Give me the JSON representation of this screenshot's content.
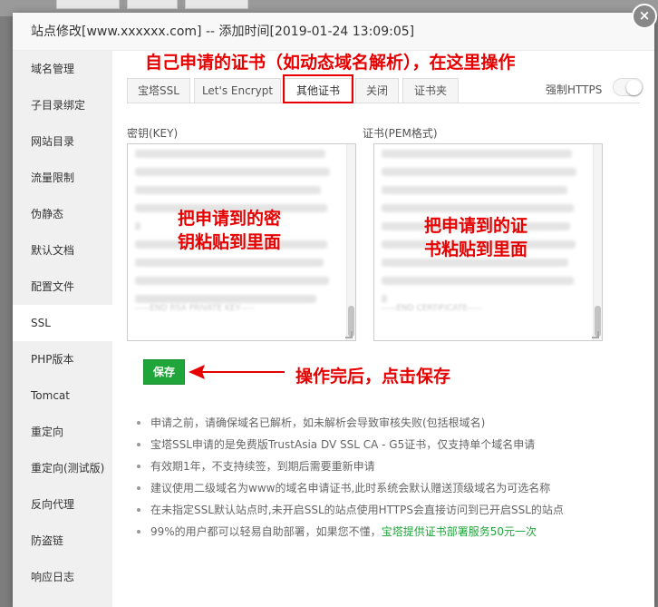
{
  "dialog": {
    "title": "站点修改[www.xxxxxx.com] -- 添加时间[2019-01-24 13:09:05]",
    "close_label": "×"
  },
  "sidebar": {
    "items": [
      {
        "label": "域名管理"
      },
      {
        "label": "子目录绑定"
      },
      {
        "label": "网站目录"
      },
      {
        "label": "流量限制"
      },
      {
        "label": "伪静态"
      },
      {
        "label": "默认文档"
      },
      {
        "label": "配置文件"
      },
      {
        "label": "SSL"
      },
      {
        "label": "PHP版本"
      },
      {
        "label": "Tomcat"
      },
      {
        "label": "重定向"
      },
      {
        "label": "重定向(测试版)"
      },
      {
        "label": "反向代理"
      },
      {
        "label": "防盗链"
      },
      {
        "label": "响应日志"
      }
    ],
    "active_item": "SSL"
  },
  "tabs": [
    {
      "label": "宝塔SSL"
    },
    {
      "label": "Let's Encrypt"
    },
    {
      "label": "其他证书"
    },
    {
      "label": "关闭"
    },
    {
      "label": "证书夹"
    }
  ],
  "active_tab": "其他证书",
  "force_https": {
    "label": "强制HTTPS",
    "enabled": false
  },
  "key_field": {
    "label": "密钥(KEY)",
    "end_line": "-----END RSA PRIVATE KEY-----"
  },
  "cert_field": {
    "label": "证书(PEM格式)",
    "end_line": "-----END CERTIFICATE-----"
  },
  "save_button": {
    "label": "保存"
  },
  "notes": [
    "申请之前，请确保域名已解析，如未解析会导致审核失败(包括根域名)",
    "宝塔SSL申请的是免费版TrustAsia DV SSL CA - G5证书，仅支持单个域名申请",
    "有效期1年，不支持续签，到期后需要重新申请",
    "建议使用二级域名为www的域名申请证书,此时系统会默认赠送顶级域名为可选名称",
    "在未指定SSL默认站点时,未开启SSL的站点使用HTTPS会直接访问到已开启SSL的站点",
    "99%的用户都可以轻易自助部署，如果您不懂，"
  ],
  "service_link": "宝塔提供证书部署服务50元一次",
  "annotations": {
    "top": "自己申请的证书（如动态域名解析），在这里操作",
    "key_line1": "把申请到的密",
    "key_line2": "钥粘贴到里面",
    "cert_line1": "把申请到的证",
    "cert_line2": "书粘贴到里面",
    "save_hint": "操作完后，点击保存"
  },
  "colors": {
    "accent_green": "#20a53a",
    "annotation_red": "#e60000"
  }
}
